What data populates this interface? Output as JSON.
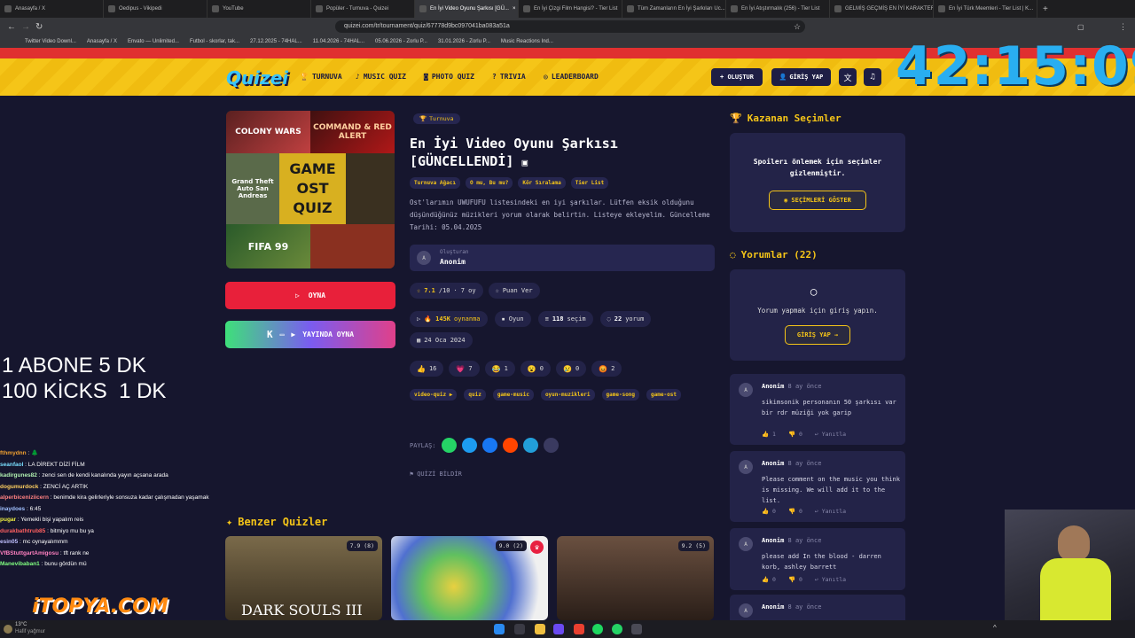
{
  "browser": {
    "tabs": [
      "Anasayfa / X",
      "Oedipus - Vikipedi",
      "YouTube",
      "Popüler - Turnuva - Quizei",
      "En İyi Video Oyunu Şarkısı [GÜ...",
      "En İyi Çizgi Film Hangisi? - Tier List",
      "Tüm Zamanların En İyi Şarkıları Uc...",
      "En İyi Atıştırmalık (256) - Tier List",
      "GELMİŞ GEÇMİŞ EN İYİ KARAKTER...",
      "En İyi Türk Meemleri - Tier List | K..."
    ],
    "tab_close": "×",
    "new_tab": "+",
    "url": "quizei.com/tr/tournament/quiz/67778d9bc097041ba083a51a",
    "bookmarks": [
      "Twitter Video Downl...",
      "Anasayfa / X",
      "Envato — Unlimited...",
      "Futbol - skorlar, tak...",
      "27.12.2025 - 74HAL...",
      "11.04.2026 - 74HAL...",
      "05.06.2026 - Zorlu P...",
      "31.01.2026 - Zorlu P...",
      "Music Reactions Ind..."
    ]
  },
  "header": {
    "logo": "Quizei",
    "nav": [
      "TURNUVA",
      "MUSIC QUIZ",
      "PHOTO QUIZ",
      "TRIVIA",
      "LEADERBOARD"
    ],
    "create_label": "+ OLUŞTUR",
    "login_label": "GİRİŞ YAP"
  },
  "timer": "42:15:09",
  "cover": {
    "top_left": "COLONY WARS",
    "top_right": "COMMAND & RED ALERT",
    "center": "GAME\nOST\nQUIZ",
    "gta": "Grand Theft Auto San Andreas",
    "fifa": "FIFA 99"
  },
  "buttons": {
    "play": "OYNA",
    "stream": "YAYINDA OYNA"
  },
  "quiz": {
    "badge": "Turnuva",
    "title": "En İyi Video Oyunu Şarkısı [GÜNCELLENDİ]",
    "modes": [
      "Turnuva Ağacı",
      "O mu, Bu mu?",
      "Kör Sıralama",
      "Tier List"
    ],
    "description": "Ost'larımın UWUFUFU listesindeki en iyi şarkılar. Lütfen eksik olduğunu düşündüğünüz müzikleri yorum olarak belirtin. Listeye ekleyelim. Güncelleme Tarihi: 05.04.2025",
    "creator_label": "Oluşturan",
    "creator_name": "Anonim",
    "creator_initial": "A",
    "rating": "7.1",
    "rating_max": "/10",
    "rating_sep": "·",
    "rating_votes": "7 oy",
    "rate_label": "Puan Ver",
    "plays": "145K",
    "plays_label": "oynanma",
    "type": "Oyun",
    "choices": "118",
    "choices_label": "seçim",
    "comments": "22",
    "comments_label": "yorum",
    "date": "24 Oca 2024",
    "reactions": [
      {
        "icon": "👍",
        "count": "16"
      },
      {
        "icon": "💗",
        "count": "7"
      },
      {
        "icon": "😂",
        "count": "1"
      },
      {
        "icon": "😮",
        "count": "0"
      },
      {
        "icon": "😢",
        "count": "0"
      },
      {
        "icon": "😡",
        "count": "2"
      }
    ],
    "hashtags": [
      "video-quiz ▶",
      "quiz",
      "game-music",
      "oyun-muzikleri",
      "game-song",
      "game-ost"
    ],
    "share_label": "PAYLAŞ:",
    "report_label": "QUİZİ BİLDİR"
  },
  "winners": {
    "title": "Kazanan Seçimler",
    "spoiler": "Spoilerı önlemek için seçimler gizlenmiştir.",
    "show_label": "SEÇİMLERİ GÖSTER"
  },
  "comments": {
    "title": "Yorumlar (22)",
    "login_prompt": "Yorum yapmak için giriş yapın.",
    "login_label": "GİRİŞ YAP",
    "reply_label": "Yanıtla",
    "items": [
      {
        "initial": "A",
        "author": "Anonim",
        "time": "8 ay önce",
        "text": "sikimsonik personanın 50 şarkısı var bir rdr müziği yok garip",
        "likes": "1",
        "dislikes": "0"
      },
      {
        "initial": "A",
        "author": "Anonim",
        "time": "8 ay önce",
        "text": "Please comment on the music you think is missing. We will add it to the list.",
        "likes": "0",
        "dislikes": "0"
      },
      {
        "initial": "A",
        "author": "Anonim",
        "time": "8 ay önce",
        "text": "please add In the blood - darren korb, ashley barrett",
        "likes": "0",
        "dislikes": "0"
      },
      {
        "initial": "A",
        "author": "Anonim",
        "time": "8 ay önce",
        "text": "",
        "likes": "",
        "dislikes": ""
      }
    ]
  },
  "similar": {
    "title": "Benzer Quizler",
    "items": [
      {
        "rating": "7.9 (8)",
        "caption": "DARK SOULS III"
      },
      {
        "rating": "9.0 (2)",
        "caption": ""
      },
      {
        "rating": "9.2 (5)",
        "caption": ""
      }
    ]
  },
  "overlay": {
    "abone": "1 ABONE 5 DK\n100 KİCKS  1 DK",
    "chat": [
      {
        "user": "fthmydnn",
        "msg": "🌲"
      },
      {
        "user": "seanfaol",
        "msg": "LA DİREKT DİZİ FİLM"
      },
      {
        "user": "kadirgunes82",
        "msg": "zenci sen de kendi kanalında yayın açsana arada"
      },
      {
        "user": "dogumurdock",
        "msg": "ZENCİ AÇ ARTIK"
      },
      {
        "user": "alperbiceniziicern",
        "msg": "benimde kira gelirleriyle sonsuza kadar çalışmadan yaşamak"
      },
      {
        "user": "inaydoes",
        "msg": "6:45"
      },
      {
        "user": "pugar",
        "msg": "Yemekli bişi yapalım reis"
      },
      {
        "user": "durakbathtrub85",
        "msg": "bitmiyo mu bu ya"
      },
      {
        "user": "esin05",
        "msg": "mc oynayalımmm"
      },
      {
        "user": "VfBStuttgartAmigosu",
        "msg": "tft rank ne"
      },
      {
        "user": "Manevibaban1",
        "msg": "bunu gördün mü"
      }
    ],
    "brand": "iTOPYA.COM"
  },
  "taskbar": {
    "weather_temp": "13°C",
    "weather_desc": "Hafif yağmur"
  },
  "colors": {
    "accent": "#f5c518",
    "background": "#16162e",
    "card": "#232348",
    "play": "#e8203a",
    "timer": "#29aef0"
  }
}
